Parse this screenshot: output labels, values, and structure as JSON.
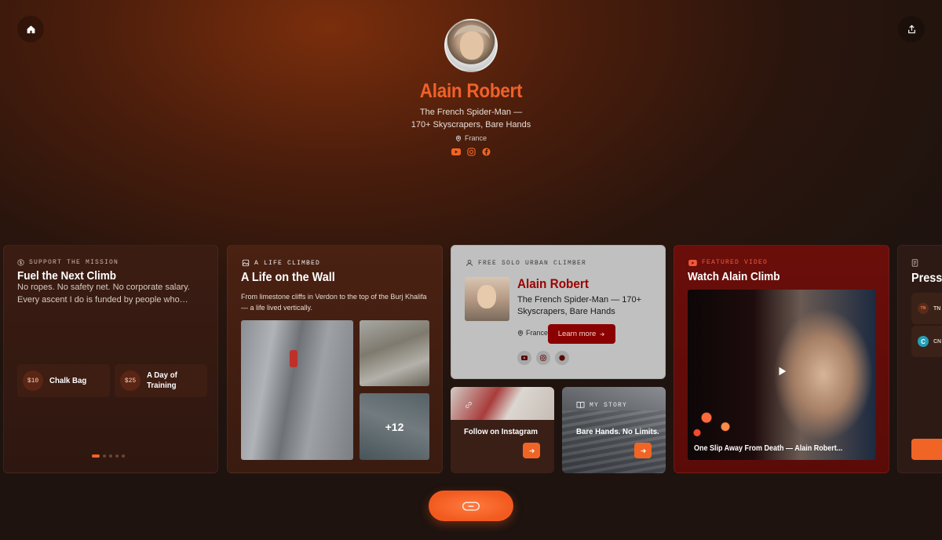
{
  "profile": {
    "name": "Alain Robert",
    "tagline_line1": "The French Spider-Man —",
    "tagline_line2": "170+ Skyscrapers, Bare Hands",
    "location": "France"
  },
  "support_card": {
    "eyebrow": "SUPPORT THE MISSION",
    "title": "Fuel the Next Climb",
    "description": "No ropes. No safety net. No corporate salary. Every ascent I do is funded by people who…",
    "tiers": [
      {
        "price": "$10",
        "name": "Chalk Bag"
      },
      {
        "price": "$25",
        "name": "A Day of Training"
      }
    ]
  },
  "gallery_card": {
    "eyebrow": "A LIFE CLIMBED",
    "title": "A Life on the Wall",
    "description": "From limestone cliffs in Verdon to the top of the Burj Khalifa — a life lived vertically.",
    "more_count": "+12"
  },
  "bio_card": {
    "eyebrow": "FREE SOLO URBAN CLIMBER",
    "name": "Alain Robert",
    "tagline": "The French Spider-Man — 170+ Skyscrapers, Bare Hands",
    "location": "France",
    "learn_more": "Learn more"
  },
  "instagram_card": {
    "title": "Follow on Instagram"
  },
  "story_card": {
    "eyebrow": "MY STORY",
    "title": "Bare Hands. No Limits."
  },
  "video_card": {
    "eyebrow": "FEATURED VIDEO",
    "title": "Watch Alain Climb",
    "caption": "One Slip Away From Death — Alain Robert..."
  },
  "press_card": {
    "title": "Press",
    "items": [
      {
        "logo": "TN",
        "label": "TN"
      },
      {
        "logo": "C",
        "label": "CN"
      }
    ]
  },
  "colors": {
    "accent": "#f06525",
    "name_color": "#f0612a",
    "bio_name": "#9b0000",
    "video_bg": "#6b0e0a"
  },
  "icons": [
    "home-icon",
    "share-icon",
    "pin-icon",
    "youtube-icon",
    "instagram-icon",
    "facebook-icon",
    "dollar-icon",
    "image-icon",
    "user-icon",
    "link-icon",
    "book-icon",
    "play-icon",
    "document-icon",
    "arrow-right-icon"
  ]
}
